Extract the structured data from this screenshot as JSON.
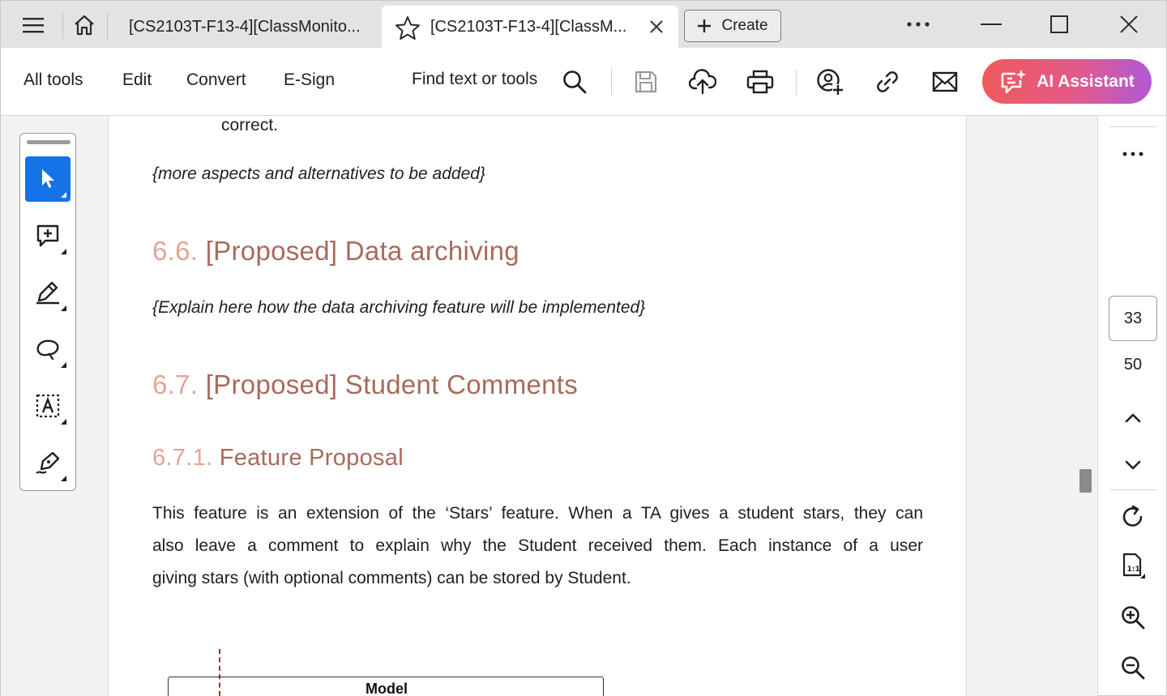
{
  "tabs": [
    {
      "title": "[CS2103T-F13-4][ClassMonito...",
      "active": false
    },
    {
      "title": "[CS2103T-F13-4][ClassM...",
      "active": true
    }
  ],
  "create_label": "Create",
  "toolbar": {
    "menu": [
      "All tools",
      "Edit",
      "Convert",
      "E-Sign"
    ],
    "find_label": "Find text or tools",
    "ai_label": "AI Assistant"
  },
  "navigation": {
    "current_page": "33",
    "total_pages": "50"
  },
  "document": {
    "fragment": "correct.",
    "note_more": "{more aspects and alternatives to be added}",
    "sec66_num": "6.6.",
    "sec66_title": "[Proposed] Data archiving",
    "note_archive": "{Explain here how the data archiving feature will be implemented}",
    "sec67_num": "6.7.",
    "sec67_title": "[Proposed] Student Comments",
    "sec671_num": "6.7.1.",
    "sec671_title": "Feature Proposal",
    "para_lines": [
      "This feature is an extension of the ‘Stars’ feature. When a TA gives a student stars, they can",
      "also leave a comment to explain why the Student received them. Each instance of a user",
      "giving stars (with optional comments) can be stored by Student."
    ],
    "diagram_label": "Model"
  },
  "colors": {
    "heading_number": "#e6a394",
    "heading_text": "#a86a5c",
    "accent_blue": "#1473e6"
  },
  "icons": {
    "window": [
      "menu-icon",
      "home-icon",
      "star-icon",
      "close-tab-icon",
      "plus-icon",
      "more-icon",
      "minimize-icon",
      "maximize-icon",
      "close-window-icon"
    ],
    "toolbar": [
      "search-icon",
      "save-icon",
      "upload-icon",
      "print-icon",
      "share-user-icon",
      "link-icon",
      "mail-icon",
      "ai-assistant-icon"
    ],
    "quick_tools": [
      "select-cursor-icon",
      "add-comment-icon",
      "highlight-pen-icon",
      "draw-lasso-icon",
      "text-box-icon",
      "sign-pen-icon"
    ],
    "right_rail": [
      "more-vertical-icon",
      "chevron-up-icon",
      "chevron-down-icon",
      "rotate-icon",
      "actual-size-icon",
      "zoom-in-icon",
      "zoom-out-icon"
    ]
  }
}
